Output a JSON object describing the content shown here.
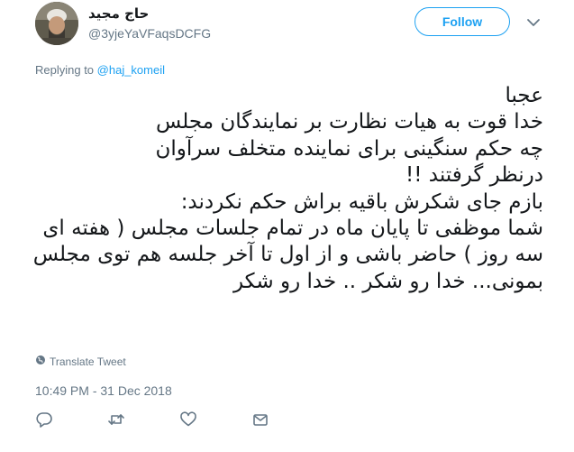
{
  "user": {
    "display_name": "حاج مجید",
    "handle": "@3yjeYaVFaqsDCFG"
  },
  "header": {
    "follow_label": "Follow"
  },
  "reply": {
    "prefix": "Replying to ",
    "to_handle": "@haj_komeil"
  },
  "tweet": {
    "text": "عجبا\nخدا قوت به هیات نظارت بر نمایندگان مجلس\nچه حکم سنگینی برای نماینده متخلف سرآوان\nدرنظر گرفتند !!\nبازم جای شکرش باقیه براش حکم نکردند:\nشما موظفی تا پایان ماه در تمام جلسات مجلس ( هفته ای سه روز ) حاضر باشی و از اول تا آخر جلسه هم توی مجلس بمونی... خدا رو شکر .. خدا رو شکر"
  },
  "footer": {
    "translate_label": "Translate Tweet",
    "timestamp": "10:49 PM - 31 Dec 2018"
  },
  "icons": {
    "reply": "reply-icon",
    "retweet": "retweet-icon",
    "like": "heart-icon",
    "message": "envelope-icon",
    "globe": "globe-icon",
    "caret": "chevron-down-icon"
  },
  "colors": {
    "accent": "#1da1f2",
    "secondary_text": "#657786",
    "icon": "#657786",
    "text": "#14171a"
  }
}
